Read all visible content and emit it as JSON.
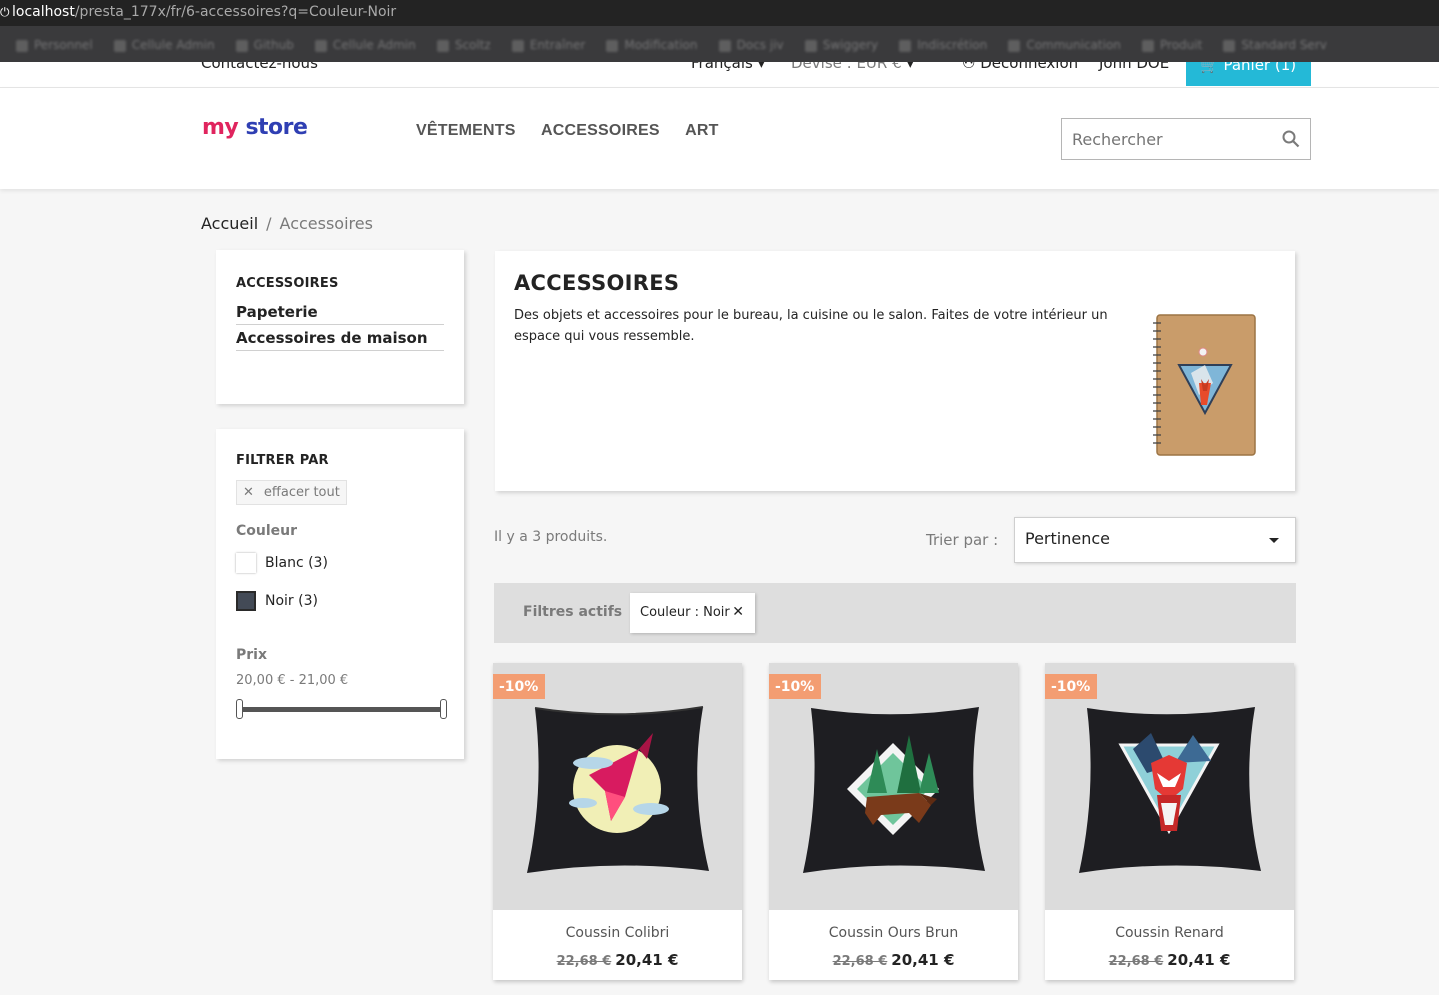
{
  "browser": {
    "url_host": "localhost",
    "url_path": "/presta_177x/fr/6-accessoires?q=Couleur-Noir",
    "bookmarks": [
      "Personnel",
      "Cellule Admin",
      "Github",
      "Cellule Admin",
      "Scoltz",
      "Entraîner",
      "Modification",
      "Docs jiv",
      "Swiggery",
      "Indiscrétion",
      "Communication",
      "Produit",
      "Standard Serv"
    ]
  },
  "topnav": {
    "contact": "Contactez-nous",
    "language": "Français",
    "currency": "Devise : EUR €",
    "logout": "Déconnexion",
    "user": "John DOE",
    "cart": "Panier (1)"
  },
  "header": {
    "logo_part1": "my",
    "logo_part2": "store",
    "menu": [
      "VÊTEMENTS",
      "ACCESSOIRES",
      "ART"
    ],
    "search_placeholder": "Rechercher"
  },
  "breadcrumb": {
    "home": "Accueil",
    "separator": "/",
    "current": "Accessoires"
  },
  "category_block": {
    "title": "ACCESSOIRES",
    "links": [
      "Papeterie",
      "Accessoires de maison"
    ]
  },
  "filters": {
    "title": "FILTRER PAR",
    "clear_all": "effacer tout",
    "color_title": "Couleur",
    "colors": [
      {
        "label": "Blanc (3)",
        "swatch": "#ffffff"
      },
      {
        "label": "Noir (3)",
        "swatch": "#434a56"
      }
    ],
    "price_title": "Prix",
    "price_range": "20,00 € - 21,00 €",
    "price_slider": {
      "min_fraction": 0,
      "max_fraction": 1
    }
  },
  "category": {
    "title": "ACCESSOIRES",
    "description": "Des objets et accessoires pour le bureau, la cuisine ou le salon. Faites de votre intérieur un espace qui vous ressemble."
  },
  "listing": {
    "count_text": "Il y a 3 produits.",
    "sort_label": "Trier par :",
    "sort_value": "Pertinence",
    "active_filters_label": "Filtres actifs",
    "active_filter": "Couleur : Noir"
  },
  "products": [
    {
      "name": "Coussin Colibri",
      "regular_price": "22,68 €",
      "price": "20,41 €",
      "discount": "-10%"
    },
    {
      "name": "Coussin Ours Brun",
      "regular_price": "22,68 €",
      "price": "20,41 €",
      "discount": "-10%"
    },
    {
      "name": "Coussin Renard",
      "regular_price": "22,68 €",
      "price": "20,41 €",
      "discount": "-10%"
    }
  ],
  "colors": {
    "accent": "#24b9d7",
    "discount_flag": "#f39d72",
    "logo_my": "#e0245e",
    "logo_store": "#2f3fb3"
  }
}
